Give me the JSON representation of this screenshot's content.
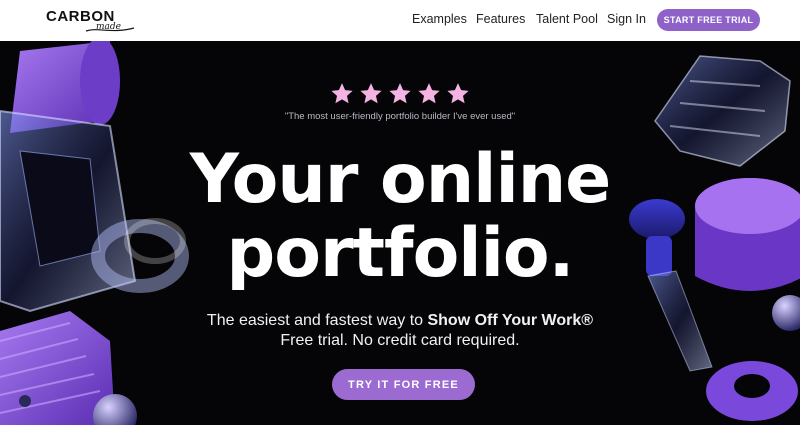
{
  "header": {
    "logo": {
      "main": "CARBON",
      "sub": "made"
    },
    "nav": [
      {
        "label": "Examples"
      },
      {
        "label": "Features"
      },
      {
        "label": "Talent Pool"
      },
      {
        "label": "Sign In"
      }
    ],
    "cta_label": "START FREE TRIAL"
  },
  "hero": {
    "rating_stars": 5,
    "testimonial": "\"The most user-friendly portfolio builder I've ever used\"",
    "headline_line1": "Your online",
    "headline_line2": "portfolio.",
    "subtitle_prefix": "The easiest and fastest way to ",
    "subtitle_emphasis": "Show Off Your Work®",
    "subtitle_line2": "Free trial. No credit card required.",
    "cta_label": "TRY IT FOR FREE"
  },
  "colors": {
    "accent": "#8e62c9",
    "hero_background": "#050507",
    "star": "#f2a8dc"
  },
  "icons": [
    "star-icon",
    "logo-swash-icon"
  ]
}
